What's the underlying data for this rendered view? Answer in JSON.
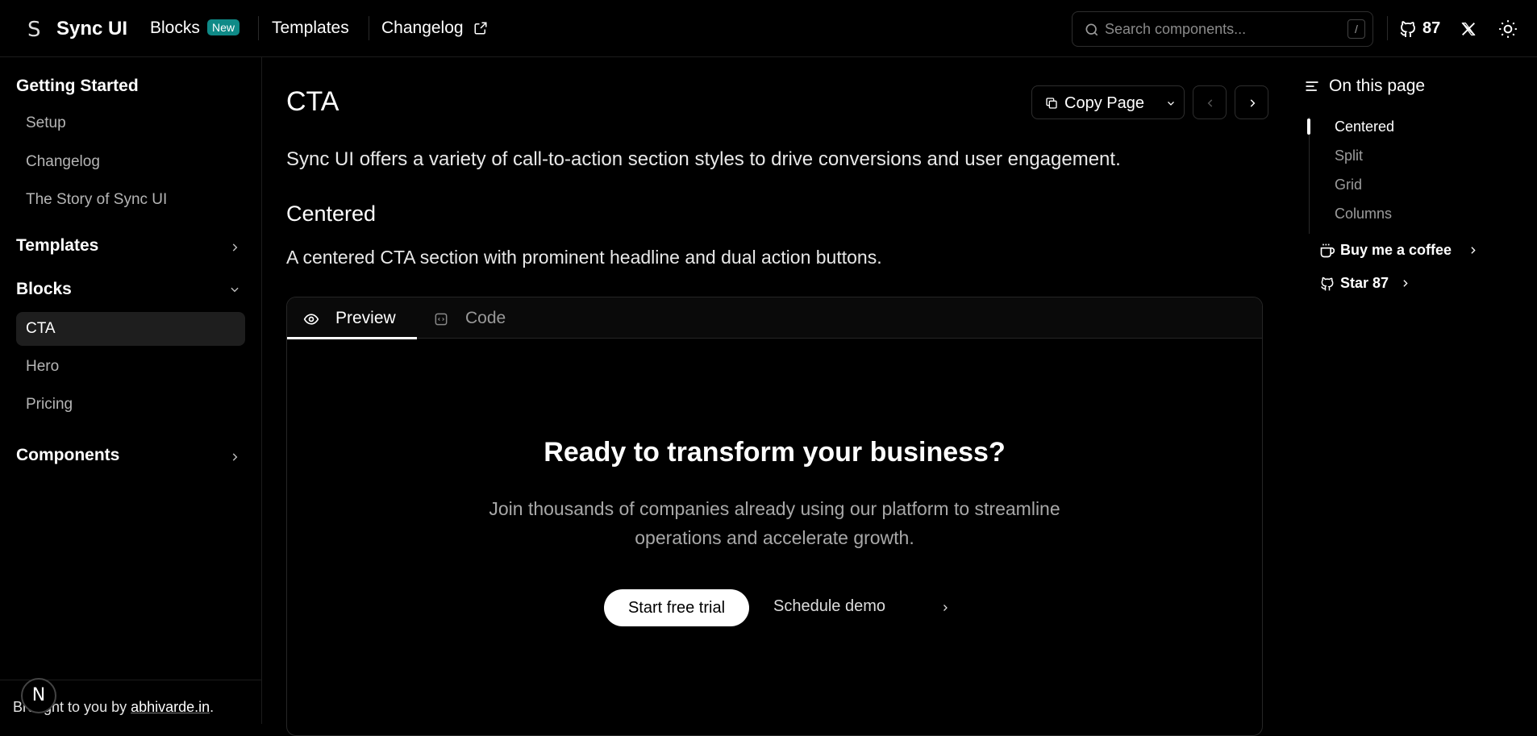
{
  "header": {
    "logo_mark": "S",
    "brand": "Sync UI",
    "nav": [
      {
        "label": "Blocks",
        "badge": "New"
      },
      {
        "label": "Templates"
      },
      {
        "label": "Changelog"
      }
    ],
    "search": {
      "placeholder": "Search components...",
      "shortcut": "/"
    },
    "github_stars": "87"
  },
  "sidebar": {
    "sections": [
      {
        "label": "Getting Started",
        "items": [
          "Setup",
          "Changelog",
          "The Story of Sync UI"
        ]
      },
      {
        "label": "Templates"
      },
      {
        "label": "Blocks",
        "items": [
          "CTA",
          "Hero",
          "Pricing"
        ],
        "active": "CTA"
      },
      {
        "label": "Components"
      }
    ],
    "footer": {
      "prefix": "Brought to you by ",
      "link": "abhivarde.in",
      "suffix": "."
    },
    "n_badge": "N"
  },
  "main": {
    "title": "CTA",
    "copy_button": "Copy Page",
    "lead": "Sync UI offers a variety of call-to-action section styles to drive conversions and user engagement.",
    "section_heading": "Centered",
    "section_desc": "A centered CTA section with prominent headline and dual action buttons.",
    "tabs": [
      "Preview",
      "Code"
    ],
    "preview": {
      "title": "Ready to transform your business?",
      "desc_line1": "Join thousands of companies already using our platform to streamline",
      "desc_line2": "operations and accelerate growth.",
      "primary": "Start free trial",
      "secondary": "Schedule demo"
    }
  },
  "toc": {
    "title": "On this page",
    "items": [
      "Centered",
      "Split",
      "Grid",
      "Columns"
    ],
    "active": "Centered",
    "coffee": "Buy me a coffee",
    "star": "Star 87"
  }
}
